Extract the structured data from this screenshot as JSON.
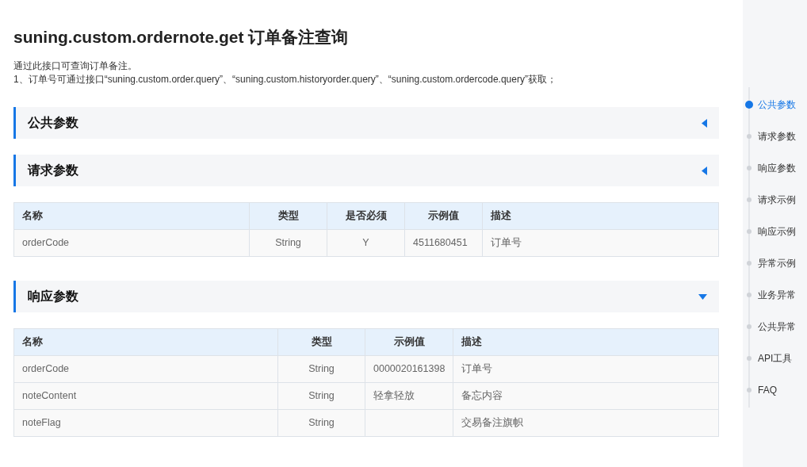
{
  "title": "suning.custom.ordernote.get 订单备注查询",
  "description": [
    "通过此接口可查询订单备注。",
    "1、订单号可通过接口“suning.custom.order.query”、“suning.custom.historyorder.query”、“suning.custom.ordercode.query”获取；"
  ],
  "sections": [
    {
      "heading": "公共参数",
      "expanded": false
    },
    {
      "heading": "请求参数",
      "expanded": false,
      "table": {
        "columns": [
          "名称",
          "类型",
          "是否必须",
          "示例值",
          "描述"
        ],
        "rows": [
          [
            "orderCode",
            "String",
            "Y",
            "4511680451",
            "订单号"
          ]
        ]
      }
    },
    {
      "heading": "响应参数",
      "expanded": true,
      "table": {
        "columns": [
          "名称",
          "类型",
          "示例值",
          "描述"
        ],
        "rows": [
          [
            "orderCode",
            "String",
            "0000020161398",
            "订单号"
          ],
          [
            "noteContent",
            "String",
            "轻拿轻放",
            "备忘内容"
          ],
          [
            "noteFlag",
            "String",
            "",
            "交易备注旗帜"
          ]
        ]
      }
    }
  ],
  "nav": [
    {
      "label": "公共参数",
      "selected": true
    },
    {
      "label": "请求参数",
      "selected": false
    },
    {
      "label": "响应参数",
      "selected": false
    },
    {
      "label": "请求示例",
      "selected": false
    },
    {
      "label": "响应示例",
      "selected": false
    },
    {
      "label": "异常示例",
      "selected": false
    },
    {
      "label": "业务异常",
      "selected": false
    },
    {
      "label": "公共异常",
      "selected": false
    },
    {
      "label": "API工具",
      "selected": false
    },
    {
      "label": "FAQ",
      "selected": false
    }
  ]
}
